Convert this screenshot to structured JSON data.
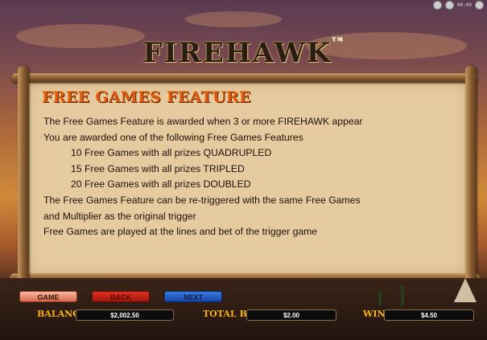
{
  "title": {
    "text": "FIREHAWK",
    "tm": "TM"
  },
  "section": {
    "title": "FREE GAMES FEATURE"
  },
  "body": {
    "line1": "The Free Games Feature is awarded when 3 or more FIREHAWK appear",
    "line2": "You are awarded one of the following Free Games Features",
    "option1": "10 Free Games with all prizes QUADRUPLED",
    "option2": "15 Free Games with all prizes TRIPLED",
    "option3": "20 Free Games with all prizes DOUBLED",
    "line6": "The Free Games Feature can be re-triggered with the same Free Games",
    "line7": "and Multiplier as the original trigger",
    "line8": "Free Games are played at the lines and bet of the trigger game"
  },
  "nav": {
    "game": "GAME",
    "back": "BACK",
    "next": "NEXT"
  },
  "status": {
    "balance_label": "BALANCE",
    "balance_value": "$2,002.50",
    "totalbet_label": "TOTAL BET",
    "totalbet_value": "$2.00",
    "win_label": "WIN",
    "win_value": "$4.50"
  },
  "system": {
    "clock": "00:00"
  },
  "colors": {
    "title_orange": "#e05a10",
    "label_gold": "#f0b020",
    "parchment": "#e6caa0"
  }
}
